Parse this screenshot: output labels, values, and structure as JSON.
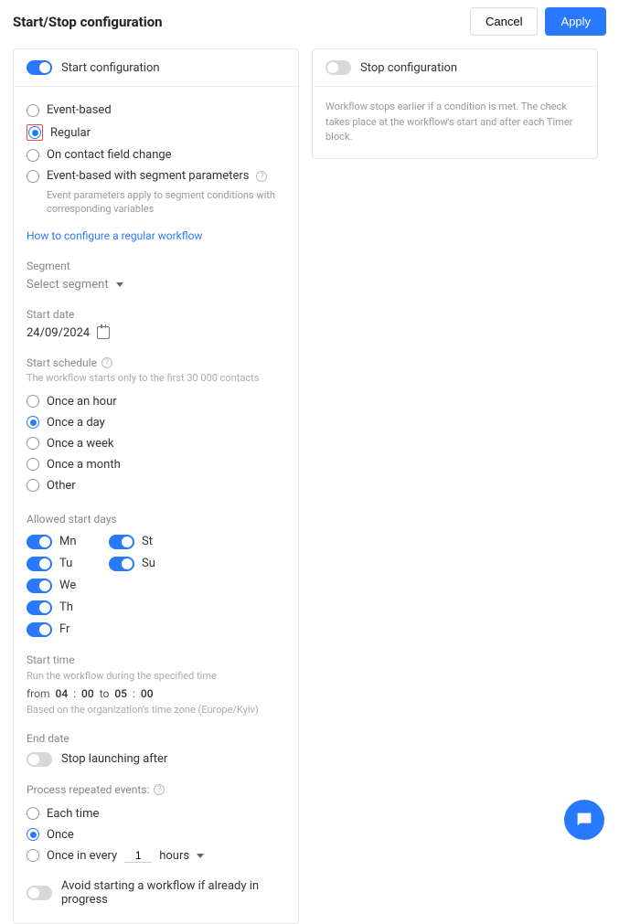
{
  "header": {
    "title": "Start/Stop configuration",
    "cancel": "Cancel",
    "apply": "Apply"
  },
  "left": {
    "title": "Start configuration",
    "triggers": {
      "event": "Event-based",
      "regular": "Regular",
      "contact": "On contact field change",
      "segment": "Event-based with segment parameters",
      "segment_desc": "Event parameters apply to segment conditions with corresponding variables"
    },
    "help_link": "How to configure a regular workflow",
    "segment_label": "Segment",
    "select_segment": "Select segment",
    "start_date_label": "Start date",
    "start_date": "24/09/2024",
    "schedule_label": "Start schedule",
    "schedule_hint": "The workflow starts only to the first 30 000 contacts",
    "schedule": {
      "hour": "Once an hour",
      "day": "Once a day",
      "week": "Once a week",
      "month": "Once a month",
      "other": "Other"
    },
    "allowed_days_label": "Allowed start days",
    "days": {
      "mn": "Mn",
      "tu": "Tu",
      "we": "We",
      "th": "Th",
      "fr": "Fr",
      "st": "St",
      "su": "Su"
    },
    "start_time_label": "Start time",
    "start_time_hint": "Run the workflow during the specified time",
    "time": {
      "from_label": "from",
      "from_h": "04",
      "from_m": "00",
      "to_label": "to",
      "to_h": "05",
      "to_m": "00",
      "colon": ":"
    },
    "tz_note": "Based on the organization's time zone (Europe/Kyiv)",
    "end_date_label": "End date",
    "stop_launching": "Stop launching after",
    "repeated_label": "Process repeated events:",
    "repeated": {
      "each": "Each time",
      "once": "Once",
      "every": "Once in every",
      "every_value": "1",
      "every_unit": "hours"
    },
    "avoid": "Avoid starting a workflow if already in progress"
  },
  "right": {
    "title": "Stop configuration",
    "desc": "Workflow stops earlier if a condition is met. The check takes place at the workflow's start and after each Timer block."
  }
}
